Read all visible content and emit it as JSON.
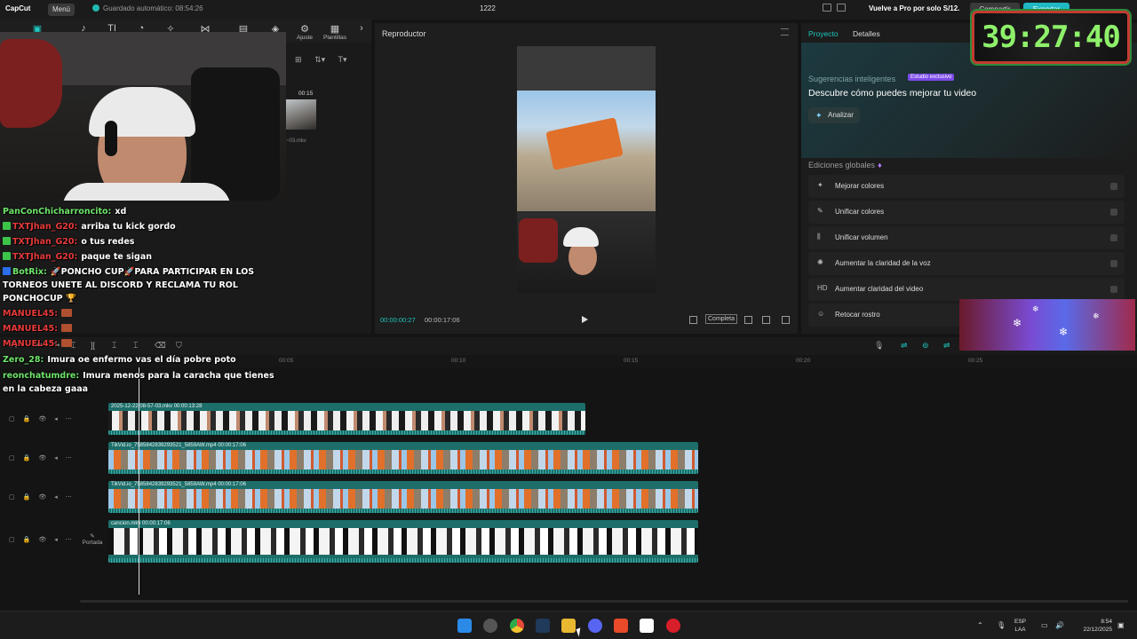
{
  "titlebar": {
    "app_name": "CapCut",
    "menu_label": "Menú",
    "save_status": "Guardado automático: 08:54:26",
    "project_title": "1222",
    "pro_offer": "Vuelve a Pro por solo S/12.",
    "share_label": "Compartir",
    "export_label": "Exportar"
  },
  "toolbar": {
    "items": [
      {
        "icon": "media-icon",
        "glyph": "▣"
      },
      {
        "icon": "audio-icon",
        "glyph": "♪"
      },
      {
        "icon": "text-icon",
        "glyph": "TI"
      },
      {
        "icon": "stickers-icon",
        "glyph": "◔"
      },
      {
        "icon": "effects-icon",
        "glyph": "✧"
      },
      {
        "icon": "transitions-icon",
        "glyph": "⋈"
      },
      {
        "icon": "captions-icon",
        "glyph": "▤"
      },
      {
        "icon": "filters-icon",
        "glyph": "◈"
      }
    ],
    "ajuste_label": "Ajuste",
    "plantillas_label": "Plantillas"
  },
  "media": {
    "clip_duration": "00:15",
    "clip_name": "~03.mkv"
  },
  "chat": [
    {
      "user": "PanConChicharroncito:",
      "text": "xd",
      "color": "green",
      "badge": ""
    },
    {
      "user": "TXTJhan_G20:",
      "text": "arriba tu kick gordo",
      "color": "red",
      "badge": "green"
    },
    {
      "user": "TXTJhan_G20:",
      "text": "o tus redes",
      "color": "red",
      "badge": "green"
    },
    {
      "user": "TXTJhan_G20:",
      "text": "paque te sigan",
      "color": "red",
      "badge": "green"
    },
    {
      "user": "BotRix:",
      "text": "🚀PONCHO CUP🚀PARA PARTICIPAR EN LOS",
      "color": "green",
      "badge": "blue"
    },
    {
      "user": "",
      "text": "TORNEOS UNETE AL DISCORD Y RECLAMA TU ROL",
      "color": "",
      "badge": ""
    },
    {
      "user": "",
      "text": "PONCHOCUP 🏆",
      "color": "",
      "badge": ""
    },
    {
      "user": "MANUEL45:",
      "text": "",
      "color": "red",
      "badge": "img"
    },
    {
      "user": "MANUEL45:",
      "text": "",
      "color": "red",
      "badge": "img"
    },
    {
      "user": "MANUEL45:",
      "text": "",
      "color": "red",
      "badge": "img"
    },
    {
      "user": "Zero_28:",
      "text": "Imura oe enfermo vas el día pobre poto",
      "color": "green",
      "badge": ""
    },
    {
      "user": "reonchatumdre:",
      "text": "Imura menos para la caracha que tienes",
      "color": "green",
      "badge": ""
    },
    {
      "user": "",
      "text": "en la cabeza gaaa",
      "color": "",
      "badge": ""
    }
  ],
  "player": {
    "title": "Reproductor",
    "current_time": "00:00:00:27",
    "total_time": "00:00:17:06",
    "ratio_label": "Completa"
  },
  "right_panel": {
    "tab_project": "Proyecto",
    "tab_details": "Detalles",
    "suggest_title": "Sugerencias inteligentes",
    "suggest_badge": "Estudio exclusivo",
    "suggest_desc": "Descubre cómo puedes mejorar tu video",
    "analyze_label": "Analizar",
    "global_title": "Ediciones globales",
    "global_items": [
      {
        "icon": "wand-icon",
        "glyph": "✦",
        "label": "Mejorar colores"
      },
      {
        "icon": "brush-icon",
        "glyph": "✎",
        "label": "Unificar colores"
      },
      {
        "icon": "volume-icon",
        "glyph": "⫼",
        "label": "Unificar volumen"
      },
      {
        "icon": "voice-icon",
        "glyph": "✺",
        "label": "Aumentar la claridad de la voz"
      },
      {
        "icon": "hd-icon",
        "glyph": "HD",
        "label": "Aumentar claridad del video"
      },
      {
        "icon": "retouch-icon",
        "glyph": "☺",
        "label": "Retocar rostro"
      }
    ]
  },
  "timer": "39:27:40",
  "timeline": {
    "ticks": [
      "00:05",
      "00:10",
      "00:15",
      "00:20",
      "00:25"
    ],
    "cover_label": "Portada",
    "clips": [
      {
        "label": "2025-12-22 08-57-03.mkv   00:00:13:28",
        "kind": "face"
      },
      {
        "label": "TikVid.io_7585842839293521_5859AW.mp4   00:00:17:06",
        "kind": "truck"
      },
      {
        "label": "TikVid.io_7585842839293521_5859AW.mp4   00:00:17:06",
        "kind": "truck"
      },
      {
        "label": "cancion.mkv   00:00:17:06",
        "kind": "song"
      }
    ]
  },
  "taskbar": {
    "lang_top": "ESP",
    "lang_bottom": "LAA",
    "time": "8:54",
    "date": "22/12/2025"
  },
  "colors": {
    "accent": "#1fc8c0",
    "clip": "#1d6e6a",
    "timer": "#8ef06a"
  }
}
